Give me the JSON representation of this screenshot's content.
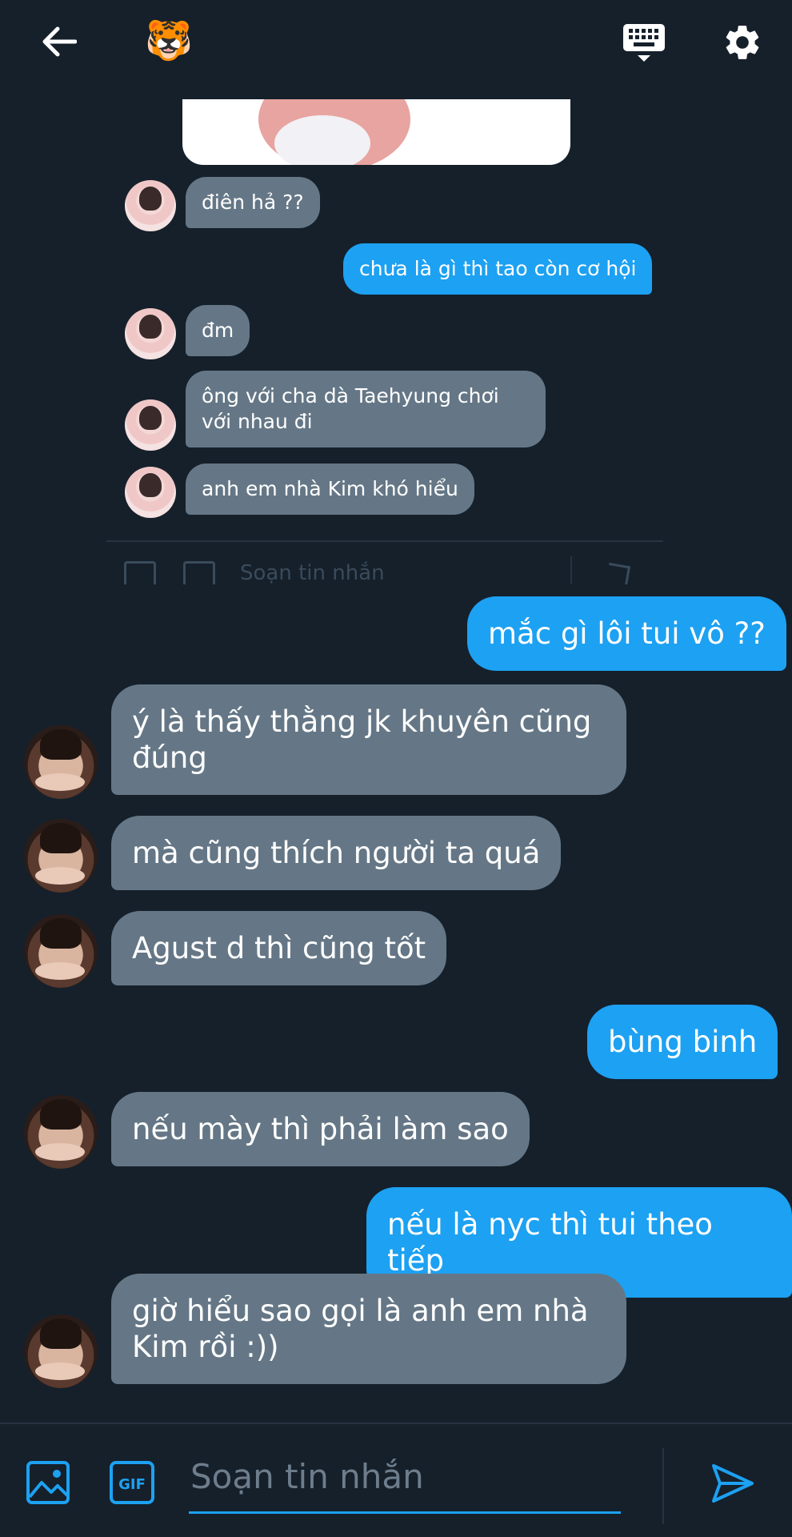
{
  "header": {
    "back_icon": "arrow-left-icon",
    "contact_avatar": "🐯",
    "keyboard_icon": "keyboard-icon",
    "settings_icon": "gear-icon"
  },
  "embedded_screenshot": {
    "messages": [
      {
        "sender": "them",
        "text": "điên hả ??"
      },
      {
        "sender": "me",
        "text": "chưa là gì thì tao còn cơ hội"
      },
      {
        "sender": "them",
        "text": "đm"
      },
      {
        "sender": "them",
        "text": "ông với cha dà Taehyung chơi với nhau đi"
      },
      {
        "sender": "them",
        "text": "anh em nhà Kim khó hiểu"
      }
    ],
    "compose_placeholder": "Soạn tin nhắn"
  },
  "messages": [
    {
      "sender": "me",
      "text": "mắc gì lôi tui vô ??"
    },
    {
      "sender": "them",
      "text": "ý là thấy thằng jk khuyên cũng đúng"
    },
    {
      "sender": "them",
      "text": "mà cũng thích người ta quá"
    },
    {
      "sender": "them",
      "text": "Agust d thì cũng tốt"
    },
    {
      "sender": "me",
      "text": "bùng binh"
    },
    {
      "sender": "them",
      "text": "nếu mày thì phải làm sao"
    },
    {
      "sender": "me",
      "text": "nếu là nyc thì tui theo tiếp"
    },
    {
      "sender": "them",
      "text": "giờ hiểu sao gọi là anh em nhà Kim rồi :))"
    }
  ],
  "composer": {
    "image_icon": "image-icon",
    "gif_label": "GIF",
    "placeholder": "Soạn tin nhắn",
    "send_icon": "send-icon"
  },
  "colors": {
    "background": "#15202b",
    "incoming_bubble": "#657786",
    "outgoing_bubble": "#1da1f2",
    "accent": "#1da1f2"
  }
}
